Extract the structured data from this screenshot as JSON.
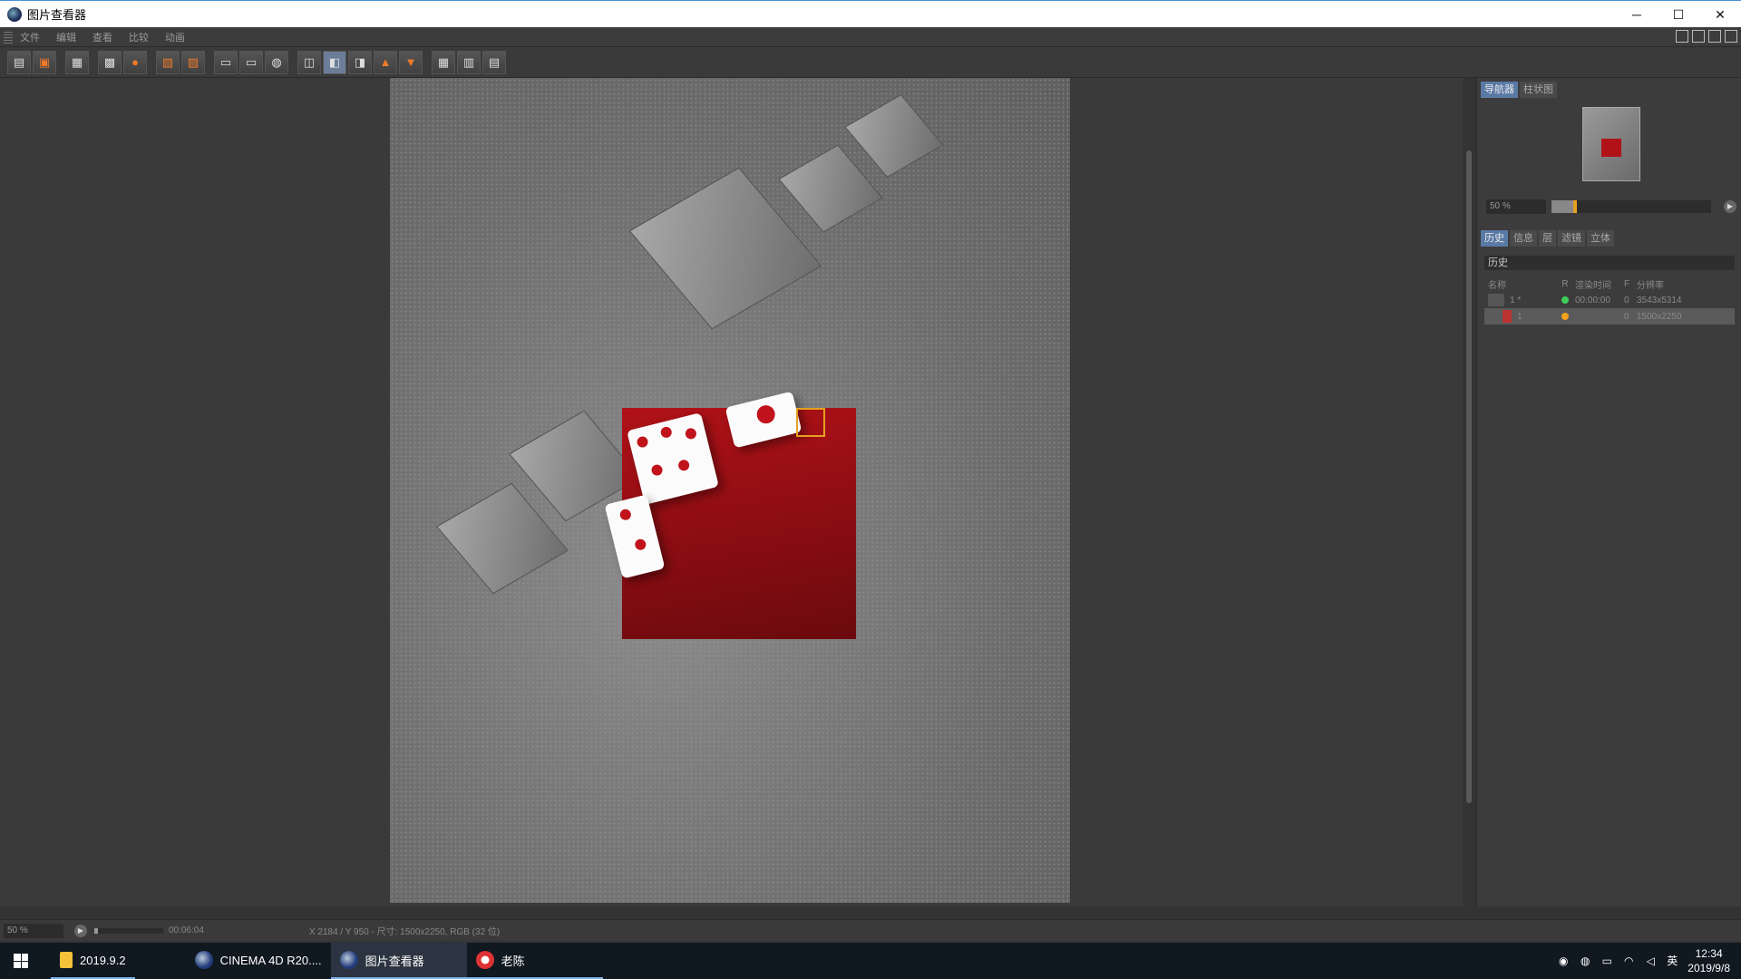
{
  "window": {
    "title": "图片查看器",
    "controls": [
      "─",
      "☐",
      "✕"
    ]
  },
  "menu": {
    "items": [
      "文件",
      "编辑",
      "查看",
      "比较",
      "动画"
    ]
  },
  "right_panel": {
    "top_tabs": [
      "导航器",
      "柱状图"
    ],
    "zoom": "50 %",
    "bottom_tabs": [
      "历史",
      "信息",
      "层",
      "滤镜",
      "立体"
    ],
    "section_title": "历史",
    "table": {
      "headers": [
        "名称",
        "R",
        "渲染时间",
        "F",
        "分辨率"
      ],
      "rows": [
        {
          "name": "1 *",
          "time": "00:00:00",
          "f": "0",
          "resolution": "3543x5314",
          "status": "green"
        },
        {
          "name": "1",
          "time": "",
          "f": "0",
          "resolution": "1500x2250",
          "status": "orange"
        }
      ]
    },
    "zoom_progress": 0.15
  },
  "status": {
    "zoom": "50 %",
    "time": "00:06:04",
    "info": "X 2184 / Y 950 - 尺寸: 1500x2250, RGB (32 位)",
    "progress": 0.05
  },
  "taskbar": {
    "items": [
      "2019.9.2",
      "CINEMA 4D R20....",
      "图片查看器",
      "老陈"
    ],
    "ime": "英",
    "time": "12:34",
    "date": "2019/9/8"
  },
  "colors": {
    "accent": "#5a7aa6",
    "render_red": "#b01218",
    "selection": "#e5a020"
  }
}
